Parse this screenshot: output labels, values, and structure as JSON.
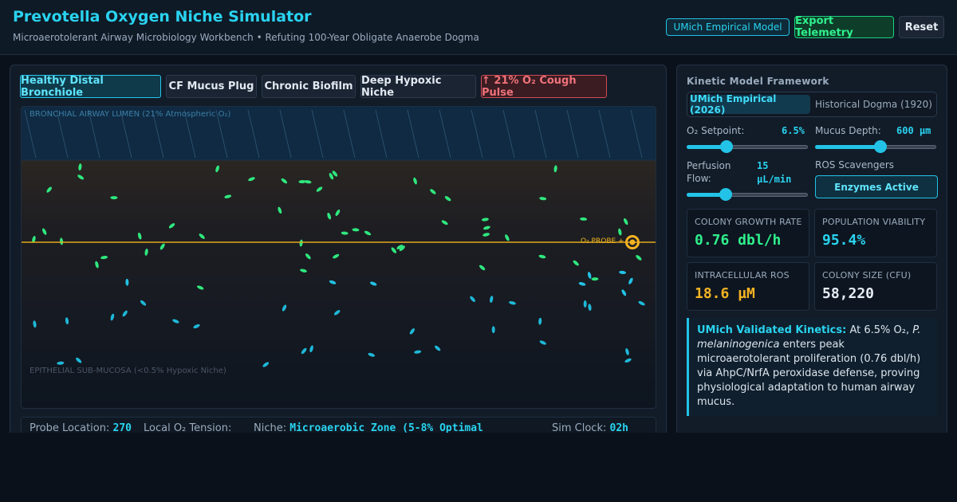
{
  "header": {
    "title": "Prevotella Oxygen Niche Simulator",
    "subtitle": "Microaerotolerant Airway Microbiology Workbench • Refuting 100-Year Obligate Anaerobe Dogma",
    "model_badge": "UMich Empirical Model",
    "export_label": "Export Telemetry",
    "reset_label": "Reset"
  },
  "scenarios": [
    {
      "label": "Healthy Distal Bronchiole",
      "state": "active"
    },
    {
      "label": "CF Mucus Plug",
      "state": "normal"
    },
    {
      "label": "Chronic Biofilm",
      "state": "normal"
    },
    {
      "label": "Deep Hypoxic Niche",
      "state": "normal"
    },
    {
      "label": "↑ 21% O₂ Cough Pulse",
      "state": "warning"
    }
  ],
  "simulation": {
    "lumen_label": "BRONCHIAL AIRWAY LUMEN (21% Atmospheric O₂)",
    "mucosa_label": "EPITHELIAL SUB-MUCOSA (<0.5% Hypoxic Niche)",
    "probe_label": "O₂ PROBE +"
  },
  "status": {
    "probe_label": "Probe Location:",
    "probe_value": "270",
    "tension_label": "Local O₂ Tension:",
    "niche_label": "Niche:",
    "niche_value": "Microaerobic Zone (5-8% Optimal",
    "clock_label": "Sim Clock:",
    "clock_value": "02h"
  },
  "framework": {
    "title": "Kinetic Model Framework",
    "options": [
      "UMich Empirical (2026)",
      "Historical Dogma (1920)"
    ],
    "selected": 0
  },
  "controls": {
    "o2_label": "O₂ Setpoint:",
    "o2_value": "6.5%",
    "o2_level": 0.33,
    "mucus_label": "Mucus Depth:",
    "mucus_value": "600 µm",
    "mucus_level": 0.54,
    "flow_label": "Perfusion Flow:",
    "flow_value": "15 µL/min",
    "flow_level": 0.32,
    "ros_label": "ROS Scavengers",
    "ros_button": "Enzymes Active"
  },
  "metrics": [
    {
      "label": "COLONY GROWTH RATE",
      "value": "0.76 dbl/h",
      "color": "#2ff08c"
    },
    {
      "label": "POPULATION VIABILITY",
      "value": "95.4%",
      "color": "#29d3f0"
    },
    {
      "label": "INTRACELLULAR ROS",
      "value": "18.6 µM",
      "color": "#f5b323"
    },
    {
      "label": "COLONY SIZE (CFU)",
      "value": "58,220",
      "color": "#e6edf5"
    }
  ],
  "insight": {
    "heading": "UMich Validated Kinetics:",
    "p1": " At 6.5% O₂, ",
    "species": "P. melaninogenica",
    "p2": " enters peak microaerotolerant proliferation (0.76 dbl/h) via AhpC/NrfA peroxidase defense, proving physiological adaptation to human airway mucus."
  }
}
